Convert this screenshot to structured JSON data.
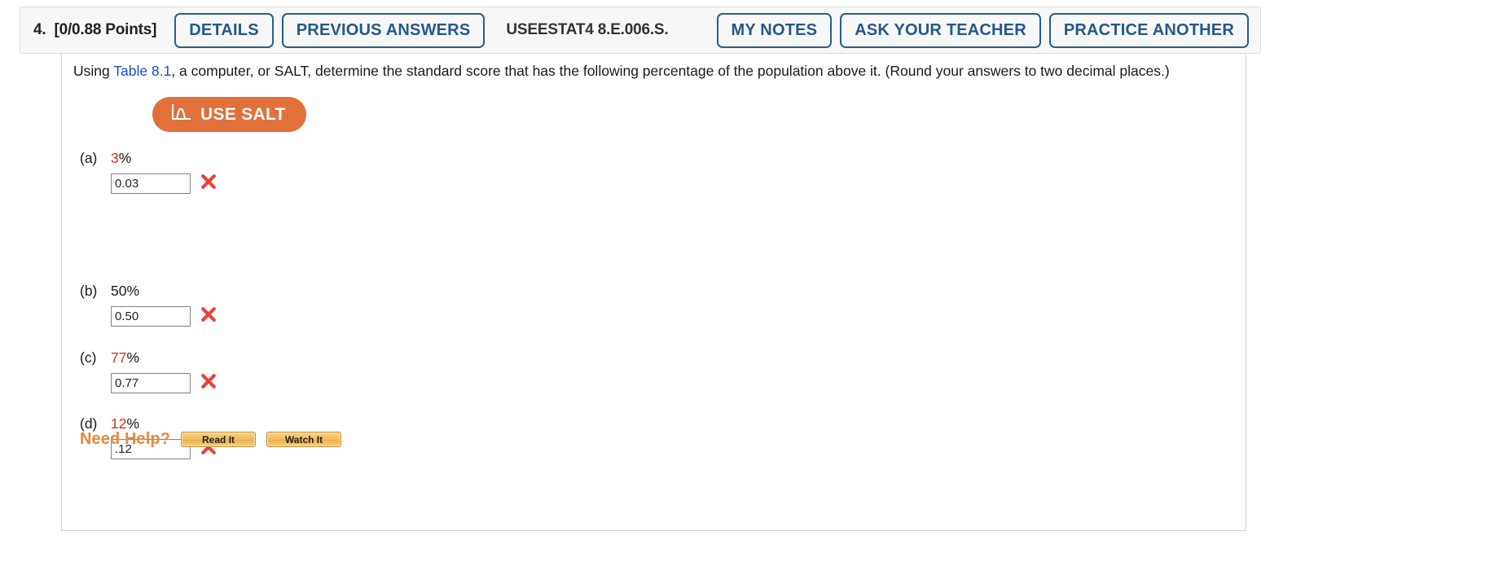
{
  "header": {
    "question_number": "4.",
    "points": "[0/0.88 Points]",
    "details_label": "DETAILS",
    "previous_answers_label": "PREVIOUS ANSWERS",
    "question_code": "USEESTAT4 8.E.006.S.",
    "my_notes_label": "MY NOTES",
    "ask_your_teacher_label": "ASK YOUR TEACHER",
    "practice_another_label": "PRACTICE ANOTHER",
    "accent_color": "#24588c",
    "background_color": "#f7f7f7"
  },
  "question": {
    "text_before_link": "Using ",
    "link_label": "Table 8.1",
    "text_after_link": ", a computer, or SALT, determine the standard score that has the following percentage of the population above it. (Round your answers to two decimal places.)",
    "link_color": "#1a4fd6"
  },
  "salt_button": {
    "label": "USE SALT",
    "icon": "bell-curve-icon",
    "background_color": "#e2703a",
    "text_color": "#ffffff"
  },
  "parts": [
    {
      "letter": "(a)",
      "percent_value": "3",
      "percent_sign": "%",
      "percent_highlighted": true,
      "input_value": "0.03",
      "status_icon": "incorrect-x-icon",
      "status": "incorrect"
    },
    {
      "letter": "(b)",
      "percent_value": "50",
      "percent_sign": "%",
      "percent_highlighted": false,
      "input_value": "0.50",
      "status_icon": "incorrect-x-icon",
      "status": "incorrect"
    },
    {
      "letter": "(c)",
      "percent_value": "77",
      "percent_sign": "%",
      "percent_highlighted": true,
      "input_value": "0.77",
      "status_icon": "incorrect-x-icon",
      "status": "incorrect"
    },
    {
      "letter": "(d)",
      "percent_value": "12",
      "percent_sign": "%",
      "percent_highlighted": true,
      "input_value": ".12",
      "status_icon": "incorrect-x-icon",
      "status": "incorrect"
    }
  ],
  "need_help": {
    "label": "Need Help?",
    "read_it_label": "Read It",
    "watch_it_label": "Watch It",
    "label_color": "#e8883c"
  },
  "colors": {
    "incorrect_x": "#e8423a",
    "highlight_percent": "#d2321e"
  }
}
